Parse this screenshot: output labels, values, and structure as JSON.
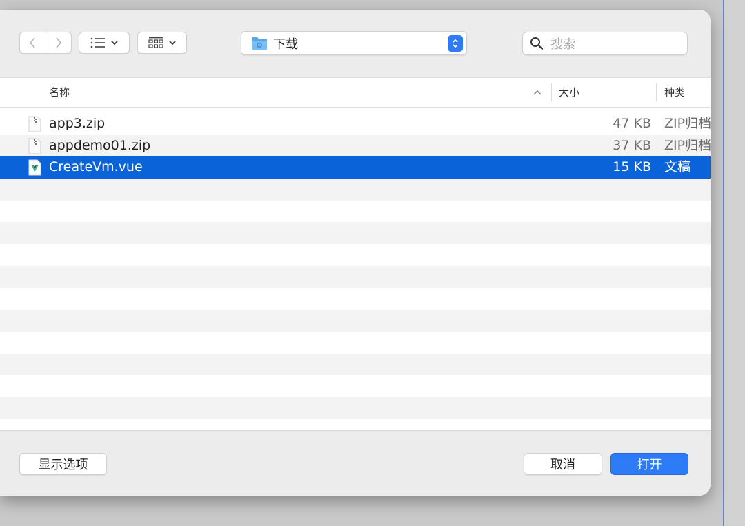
{
  "toolbar": {
    "back_icon": "chevron-left-icon",
    "forward_icon": "chevron-right-icon",
    "view_list_icon": "list-view-icon",
    "view_grid_icon": "grid-view-icon",
    "location": {
      "label": "下载",
      "icon": "folder-icon"
    },
    "search": {
      "placeholder": "搜索",
      "value": ""
    }
  },
  "columns": {
    "name": "名称",
    "size": "大小",
    "kind": "种类",
    "sort_icon": "chevron-up-icon"
  },
  "files": [
    {
      "name": "app3.zip",
      "size": "47 KB",
      "kind": "ZIP归档",
      "icon": "zip-file-icon",
      "selected": false
    },
    {
      "name": "appdemo01.zip",
      "size": "37 KB",
      "kind": "ZIP归档",
      "icon": "zip-file-icon",
      "selected": false
    },
    {
      "name": "CreateVm.vue",
      "size": "15 KB",
      "kind": "文稿",
      "icon": "vue-file-icon",
      "selected": true
    }
  ],
  "footer": {
    "options_label": "显示选项",
    "cancel_label": "取消",
    "open_label": "打开"
  },
  "colors": {
    "selection": "#0a63d8",
    "accent": "#2d7cf6"
  }
}
